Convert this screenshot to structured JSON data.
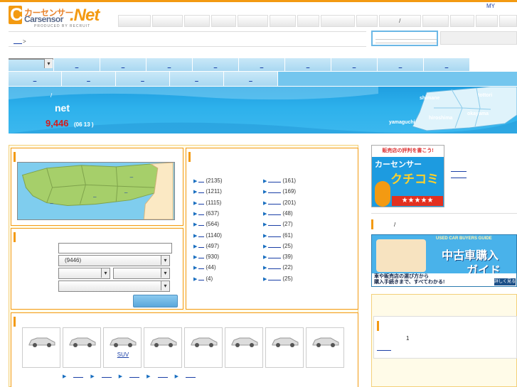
{
  "header": {
    "logo": {
      "kana": "カーセンサー",
      "brand": "Carsensor",
      "net": ".Net",
      "produced_by": "PRODUCED BY RECRUIT"
    },
    "my_link": "MY",
    "global_nav": [
      "",
      "",
      "",
      "",
      "",
      "",
      "",
      "",
      "",
      "/",
      "",
      "",
      "",
      ""
    ]
  },
  "breadcrumb": {
    "home_link": "",
    "separator": ">"
  },
  "pref_tabs_row1": [
    "",
    "",
    "",
    "",
    "",
    "",
    "",
    "",
    "",
    "",
    "",
    ""
  ],
  "pref_tabs_row2": [
    "",
    "",
    "",
    "",
    ""
  ],
  "hero": {
    "slash": "/",
    "title": "net",
    "count": "9,446",
    "updated": "(06  13     )",
    "map_labels": [
      "shimane",
      "tottori",
      "hiroshima",
      "okayama",
      "yamaguchi"
    ]
  },
  "map_panel": {},
  "search_panel": {
    "maker_select": "(9446)"
  },
  "categories": {
    "left": [
      {
        "name": "",
        "count": "(2135)"
      },
      {
        "name": "",
        "count": "(1211)"
      },
      {
        "name": "",
        "count": "(1115)"
      },
      {
        "name": "",
        "count": "(637)"
      },
      {
        "name": "",
        "count": "(564)"
      },
      {
        "name": "",
        "count": "(1140)"
      },
      {
        "name": "",
        "count": "(497)"
      },
      {
        "name": "",
        "count": "(930)"
      },
      {
        "name": "",
        "count": "(44)"
      },
      {
        "name": "",
        "count": "(4)"
      }
    ],
    "right": [
      {
        "name": "",
        "count": "(161)"
      },
      {
        "name": "",
        "count": "(169)"
      },
      {
        "name": "",
        "count": "(201)"
      },
      {
        "name": "",
        "count": "(48)"
      },
      {
        "name": "",
        "count": "(27)"
      },
      {
        "name": "",
        "count": "(61)"
      },
      {
        "name": "",
        "count": "(25)"
      },
      {
        "name": "",
        "count": "(39)"
      },
      {
        "name": "",
        "count": "(22)"
      },
      {
        "name": "",
        "count": "(25)"
      }
    ]
  },
  "body_types": [
    "",
    "",
    "SUV",
    "",
    "",
    "",
    "",
    ""
  ],
  "bottom_links": [
    "",
    "",
    "",
    "",
    ""
  ],
  "sidebar": {
    "kuchikomi": {
      "headline": "販売店の評判を書こう!",
      "brand": "カーセンサー",
      "title": "クチコミ"
    },
    "slash": "/",
    "guide": {
      "top": "USED CAR BUYERS GUIDE",
      "title1": "中古車購入",
      "title2": "ガイド",
      "sub1": "車や販売店の選び方から",
      "sub2": "購入手続きまで、すべてわかる!",
      "more": "詳しく見る"
    },
    "small_num": "1"
  }
}
